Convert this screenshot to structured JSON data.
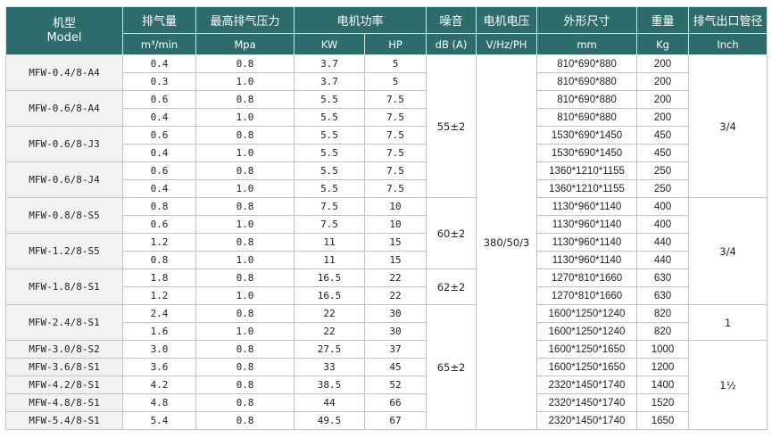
{
  "headers": {
    "model": "机型",
    "model_en": "Model",
    "flow": "排气量",
    "flow_unit": "m³/min",
    "pressure": "最高排气压力",
    "pressure_unit": "Mpa",
    "power": "电机功率",
    "power_kw": "KW",
    "power_hp": "HP",
    "noise": "噪音",
    "noise_unit": "dB (A)",
    "voltage": "电机电压",
    "voltage_unit": "V/Hz/PH",
    "dimensions": "外形尺寸",
    "dimensions_unit": "mm",
    "weight": "重量",
    "weight_unit": "Kg",
    "outlet": "排气出口管径",
    "outlet_unit": "Inch"
  },
  "models": [
    "MFW-0.4/8-A4",
    "MFW-0.6/8-A4",
    "MFW-0.6/8-J3",
    "MFW-0.6/8-J4",
    "MFW-0.8/8-S5",
    "MFW-1.2/8-S5",
    "MFW-1.8/8-S1",
    "MFW-2.4/8-S1",
    "MFW-3.0/8-S2",
    "MFW-3.6/8-S1",
    "MFW-4.2/8-S1",
    "MFW-4.8/8-S1",
    "MFW-5.4/8-S1"
  ],
  "rows": [
    {
      "flow": "0.4",
      "pressure": "0.8",
      "kw": "3.7",
      "hp": "5",
      "dim": "810*690*880",
      "weight": "200"
    },
    {
      "flow": "0.3",
      "pressure": "1.0",
      "kw": "3.7",
      "hp": "5",
      "dim": "810*690*880",
      "weight": "200"
    },
    {
      "flow": "0.6",
      "pressure": "0.8",
      "kw": "5.5",
      "hp": "7.5",
      "dim": "810*690*880",
      "weight": "200"
    },
    {
      "flow": "0.4",
      "pressure": "1.0",
      "kw": "5.5",
      "hp": "7.5",
      "dim": "810*690*880",
      "weight": "200"
    },
    {
      "flow": "0.6",
      "pressure": "0.8",
      "kw": "5.5",
      "hp": "7.5",
      "dim": "1530*690*1450",
      "weight": "450"
    },
    {
      "flow": "0.4",
      "pressure": "1.0",
      "kw": "5.5",
      "hp": "7.5",
      "dim": "1530*690*1450",
      "weight": "450"
    },
    {
      "flow": "0.6",
      "pressure": "0.8",
      "kw": "5.5",
      "hp": "7.5",
      "dim": "1360*1210*1155",
      "weight": "250"
    },
    {
      "flow": "0.4",
      "pressure": "1.0",
      "kw": "5.5",
      "hp": "7.5",
      "dim": "1360*1210*1155",
      "weight": "250"
    },
    {
      "flow": "0.8",
      "pressure": "0.8",
      "kw": "7.5",
      "hp": "10",
      "dim": "1130*960*1140",
      "weight": "400"
    },
    {
      "flow": "0.6",
      "pressure": "1.0",
      "kw": "7.5",
      "hp": "10",
      "dim": "1130*960*1140",
      "weight": "400"
    },
    {
      "flow": "1.2",
      "pressure": "0.8",
      "kw": "11",
      "hp": "15",
      "dim": "1130*960*1140",
      "weight": "440"
    },
    {
      "flow": "0.8",
      "pressure": "1.0",
      "kw": "11",
      "hp": "15",
      "dim": "1130*960*1140",
      "weight": "440"
    },
    {
      "flow": "1.8",
      "pressure": "0.8",
      "kw": "16.5",
      "hp": "22",
      "dim": "1270*810*1660",
      "weight": "630"
    },
    {
      "flow": "1.2",
      "pressure": "1.0",
      "kw": "16.5",
      "hp": "22",
      "dim": "1270*810*1660",
      "weight": "630"
    },
    {
      "flow": "2.4",
      "pressure": "0.8",
      "kw": "22",
      "hp": "30",
      "dim": "1600*1250*1240",
      "weight": "820"
    },
    {
      "flow": "1.6",
      "pressure": "1.0",
      "kw": "22",
      "hp": "30",
      "dim": "1600*1250*1240",
      "weight": "820"
    },
    {
      "flow": "3.0",
      "pressure": "0.8",
      "kw": "27.5",
      "hp": "37",
      "dim": "1600*1250*1650",
      "weight": "1000"
    },
    {
      "flow": "3.6",
      "pressure": "0.8",
      "kw": "33",
      "hp": "45",
      "dim": "1600*1250*1650",
      "weight": "1200"
    },
    {
      "flow": "4.2",
      "pressure": "0.8",
      "kw": "38.5",
      "hp": "52",
      "dim": "2320*1450*1740",
      "weight": "1400"
    },
    {
      "flow": "4.8",
      "pressure": "0.8",
      "kw": "44",
      "hp": "66",
      "dim": "2320*1450*1740",
      "weight": "1520"
    },
    {
      "flow": "5.4",
      "pressure": "0.8",
      "kw": "49.5",
      "hp": "67",
      "dim": "2320*1450*1740",
      "weight": "1650"
    }
  ],
  "noise": [
    "55±2",
    "60±2",
    "62±2",
    "65±2"
  ],
  "voltage": "380/50/3",
  "outlet": [
    "3/4",
    "3/4",
    "1",
    "1½"
  ]
}
